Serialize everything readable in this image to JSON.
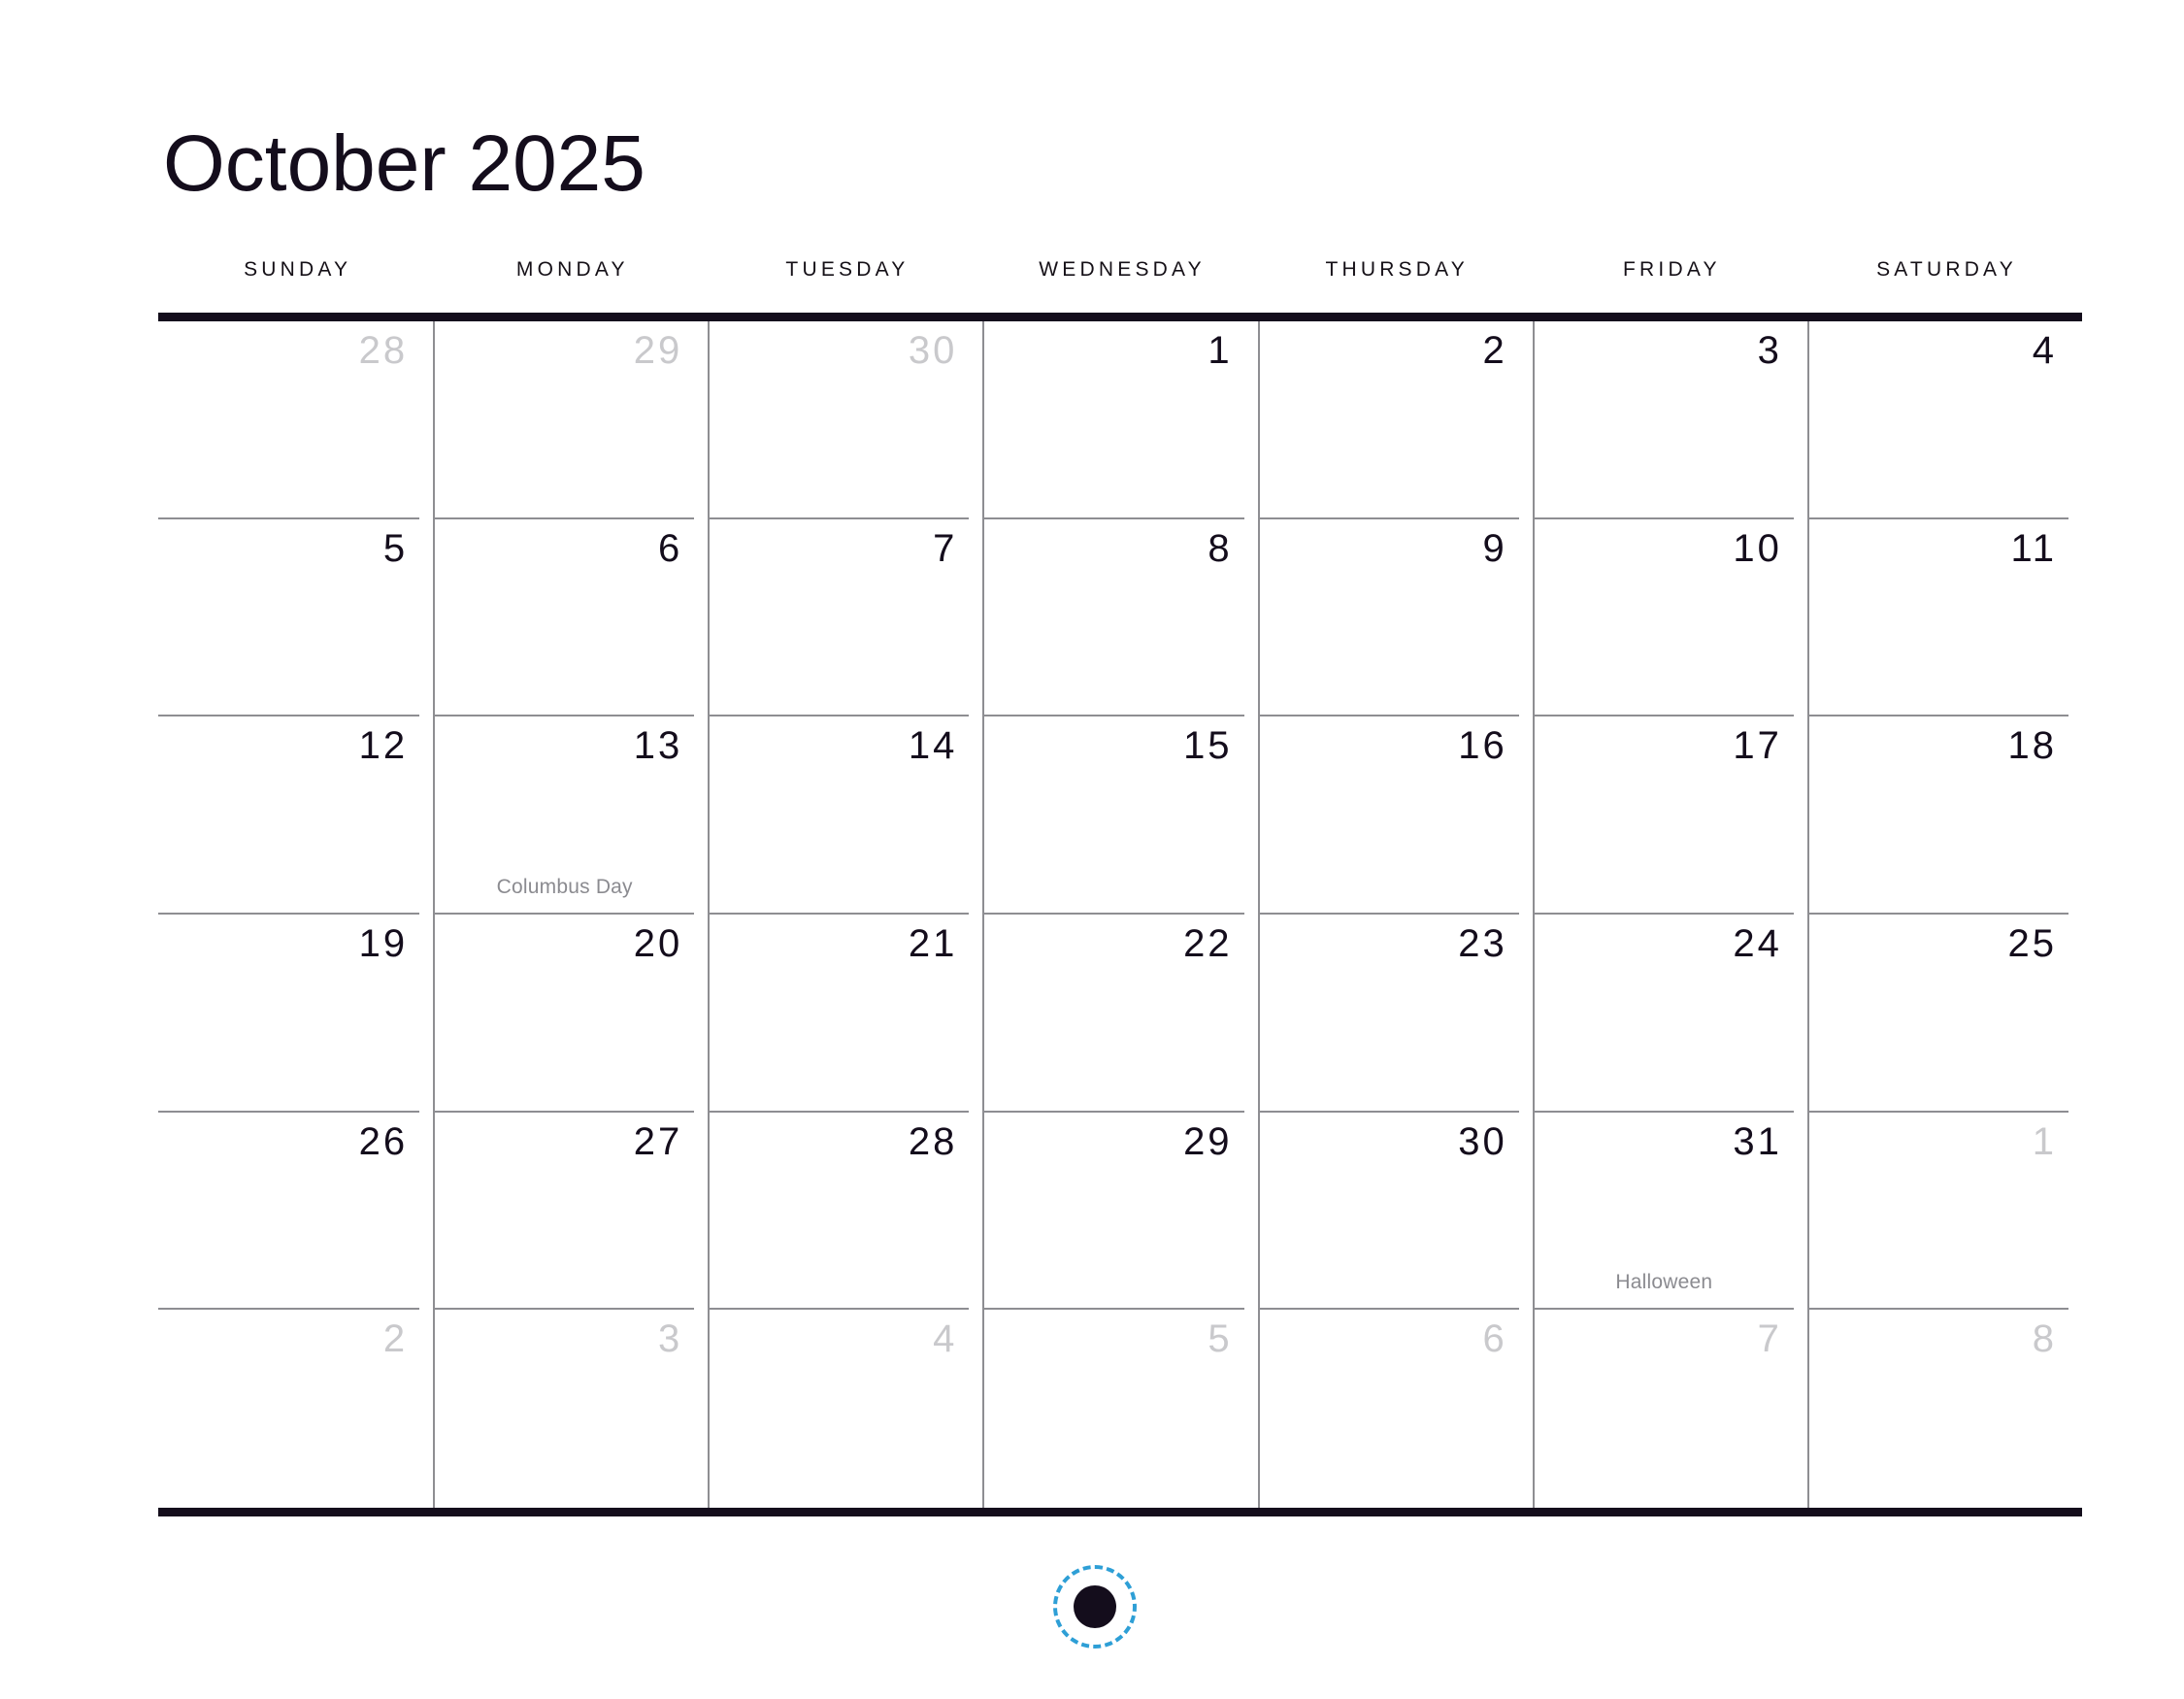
{
  "calendar": {
    "title": "October 2025",
    "month": "October",
    "year": "2025",
    "weekday_headers": [
      "SUNDAY",
      "MONDAY",
      "TUESDAY",
      "WEDNESDAY",
      "THURSDAY",
      "FRIDAY",
      "SATURDAY"
    ],
    "colors": {
      "text": "#140d1c",
      "muted_day": "#c9c9cc",
      "holiday_text": "#8b8b90",
      "grid_line": "#8e8e92",
      "rule": "#140d1c",
      "cursor_ring": "#2e9fd6",
      "background": "#ffffff"
    },
    "weeks": [
      [
        {
          "num": "28",
          "muted": true,
          "holiday": ""
        },
        {
          "num": "29",
          "muted": true,
          "holiday": ""
        },
        {
          "num": "30",
          "muted": true,
          "holiday": ""
        },
        {
          "num": "1",
          "muted": false,
          "holiday": ""
        },
        {
          "num": "2",
          "muted": false,
          "holiday": ""
        },
        {
          "num": "3",
          "muted": false,
          "holiday": ""
        },
        {
          "num": "4",
          "muted": false,
          "holiday": ""
        }
      ],
      [
        {
          "num": "5",
          "muted": false,
          "holiday": ""
        },
        {
          "num": "6",
          "muted": false,
          "holiday": ""
        },
        {
          "num": "7",
          "muted": false,
          "holiday": ""
        },
        {
          "num": "8",
          "muted": false,
          "holiday": ""
        },
        {
          "num": "9",
          "muted": false,
          "holiday": ""
        },
        {
          "num": "10",
          "muted": false,
          "holiday": ""
        },
        {
          "num": "11",
          "muted": false,
          "holiday": ""
        }
      ],
      [
        {
          "num": "12",
          "muted": false,
          "holiday": ""
        },
        {
          "num": "13",
          "muted": false,
          "holiday": "Columbus Day"
        },
        {
          "num": "14",
          "muted": false,
          "holiday": ""
        },
        {
          "num": "15",
          "muted": false,
          "holiday": ""
        },
        {
          "num": "16",
          "muted": false,
          "holiday": ""
        },
        {
          "num": "17",
          "muted": false,
          "holiday": ""
        },
        {
          "num": "18",
          "muted": false,
          "holiday": ""
        }
      ],
      [
        {
          "num": "19",
          "muted": false,
          "holiday": ""
        },
        {
          "num": "20",
          "muted": false,
          "holiday": ""
        },
        {
          "num": "21",
          "muted": false,
          "holiday": ""
        },
        {
          "num": "22",
          "muted": false,
          "holiday": ""
        },
        {
          "num": "23",
          "muted": false,
          "holiday": ""
        },
        {
          "num": "24",
          "muted": false,
          "holiday": ""
        },
        {
          "num": "25",
          "muted": false,
          "holiday": ""
        }
      ],
      [
        {
          "num": "26",
          "muted": false,
          "holiday": ""
        },
        {
          "num": "27",
          "muted": false,
          "holiday": ""
        },
        {
          "num": "28",
          "muted": false,
          "holiday": ""
        },
        {
          "num": "29",
          "muted": false,
          "holiday": ""
        },
        {
          "num": "30",
          "muted": false,
          "holiday": ""
        },
        {
          "num": "31",
          "muted": false,
          "holiday": "Halloween"
        },
        {
          "num": "1",
          "muted": true,
          "holiday": ""
        }
      ],
      [
        {
          "num": "2",
          "muted": true,
          "holiday": ""
        },
        {
          "num": "3",
          "muted": true,
          "holiday": ""
        },
        {
          "num": "4",
          "muted": true,
          "holiday": ""
        },
        {
          "num": "5",
          "muted": true,
          "holiday": ""
        },
        {
          "num": "6",
          "muted": true,
          "holiday": ""
        },
        {
          "num": "7",
          "muted": true,
          "holiday": ""
        },
        {
          "num": "8",
          "muted": true,
          "holiday": ""
        }
      ]
    ]
  },
  "cursor": {
    "name": "click-indicator"
  }
}
